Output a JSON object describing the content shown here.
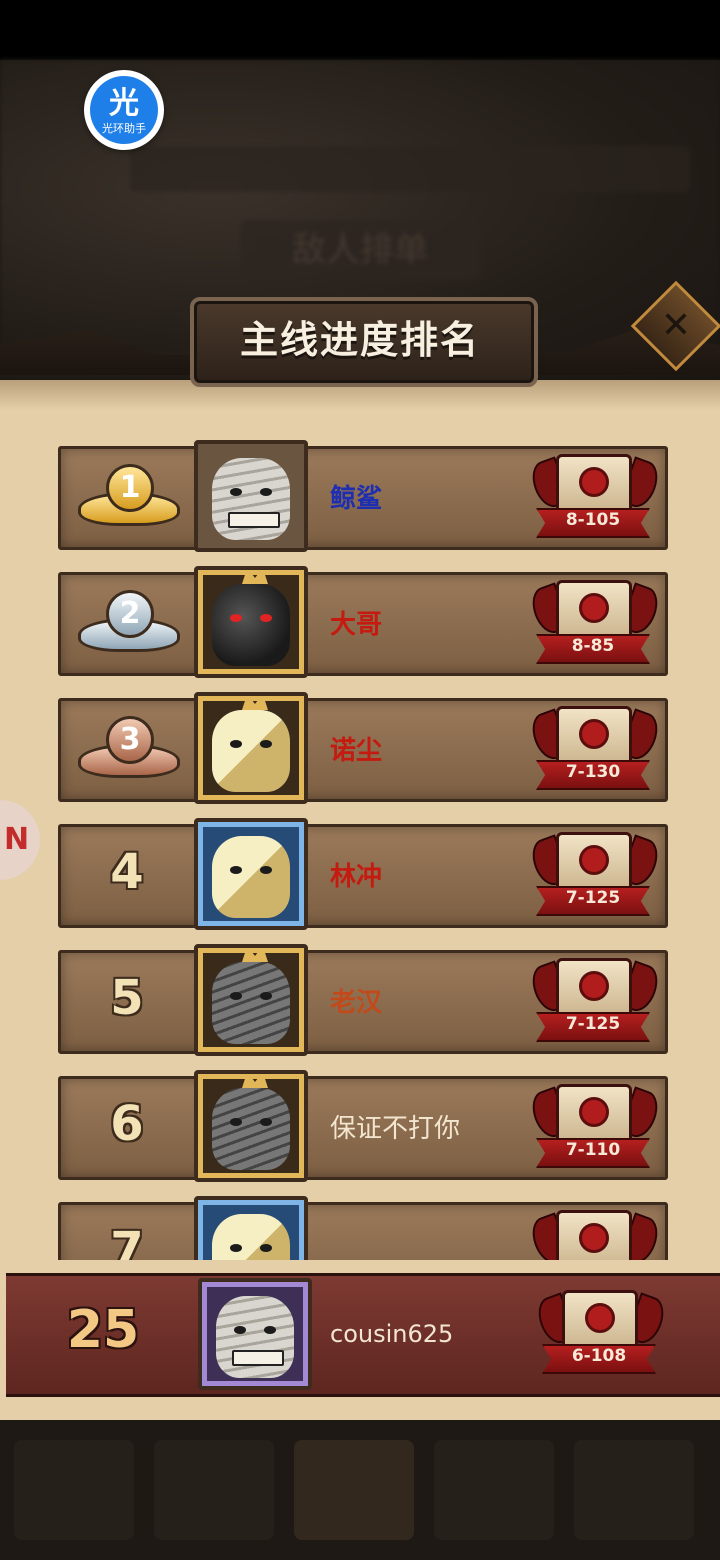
{
  "title": "主线进度排名",
  "overlay_badge": {
    "glyph": "光",
    "sub": "光环助手"
  },
  "background_title": "敌人排单",
  "close_label": "✕",
  "side_tab_glyph": "N",
  "rows": [
    {
      "rank": "1",
      "medal": "gold",
      "name": "鲸鲨",
      "name_color": "#1d2fb0",
      "stage": "8-105",
      "frame": "plain",
      "face": "mummy"
    },
    {
      "rank": "2",
      "medal": "silver",
      "name": "大哥",
      "name_color": "#c51a0f",
      "stage": "8-85",
      "frame": "gold",
      "face": "dark"
    },
    {
      "rank": "3",
      "medal": "bronze",
      "name": "诺尘",
      "name_color": "#c51a0f",
      "stage": "7-130",
      "frame": "gold",
      "face": "blonde"
    },
    {
      "rank": "4",
      "medal": "none",
      "name": "林冲",
      "name_color": "#c51a0f",
      "stage": "7-125",
      "frame": "blue",
      "face": "blonde"
    },
    {
      "rank": "5",
      "medal": "none",
      "name": "老汉",
      "name_color": "#c24a1a",
      "stage": "7-125",
      "frame": "gold",
      "face": "grey"
    },
    {
      "rank": "6",
      "medal": "none",
      "name": "保证不打你",
      "name_color": "#f3e6d0",
      "stage": "7-110",
      "frame": "gold",
      "face": "grey"
    },
    {
      "rank": "7",
      "medal": "none",
      "name": "",
      "name_color": "#f3e6d0",
      "stage": "",
      "frame": "blue",
      "face": "blonde"
    }
  ],
  "self": {
    "rank": "25",
    "name": "cousin625",
    "stage": "6-108"
  }
}
